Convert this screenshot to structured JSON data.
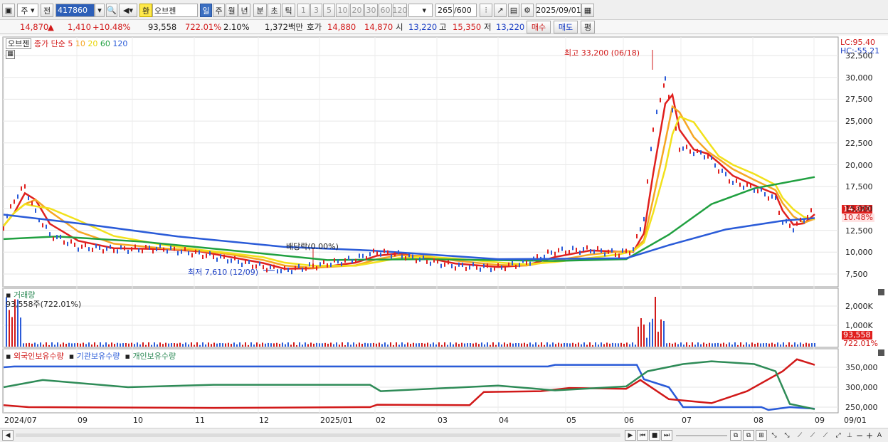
{
  "toolbar": {
    "market": "주",
    "prev": "전",
    "code": "417860",
    "tag": "환",
    "name": "오브젠",
    "periods": [
      "일",
      "주",
      "월",
      "년",
      "분",
      "초",
      "틱"
    ],
    "minutes": [
      "1",
      "3",
      "5",
      "10",
      "20",
      "30",
      "60",
      "120"
    ],
    "count": "265",
    "count_total": "/600",
    "date": "2025/09/01"
  },
  "info": {
    "price": "14,870",
    "change": "1,410",
    "change_pct": "+10.48%",
    "volume": "93,558",
    "volume_pct": "722.01%",
    "turnover": "2.10%",
    "amount": "1,372백만",
    "ask_label": "호가",
    "ask1": "14,880",
    "ask2": "14,870",
    "open_label": "시",
    "open": "13,220",
    "high_label": "고",
    "high": "15,350",
    "low_label": "저",
    "low": "13,220",
    "buy": "매수",
    "sell": "매도",
    "eval": "평"
  },
  "price_panel": {
    "name": "오브젠",
    "ma_label": "종가 단순",
    "ma_periods": [
      "5",
      "10",
      "20",
      "60",
      "120"
    ],
    "ma_colors": [
      "#e0201e",
      "#f5a623",
      "#f2e11b",
      "#20a040",
      "#2a5bd8"
    ],
    "lc": "LC:95.40",
    "hc": "HC:-55.21",
    "high_note": "최고 33,200 (06/18)",
    "low_note": "최저 7,610 (12/09)",
    "dividend_note": "배당락(0.00%)",
    "y_ticks": [
      "32,500",
      "30,000",
      "27,500",
      "25,000",
      "22,500",
      "20,000",
      "17,500",
      "15,000",
      "12,500",
      "10,000",
      "7,500"
    ],
    "last_price": "14,870",
    "last_pct": "10.48%"
  },
  "volume_panel": {
    "title": "거래량",
    "value": "93,558주(722.01%)",
    "y_ticks": [
      "2,000K",
      "1,000K"
    ],
    "last_value": "93,558",
    "last_pct": "722.01%"
  },
  "holdings_panel": {
    "series": [
      "외국인보유수량",
      "기관보유수량",
      "개인보유수량"
    ],
    "colors": [
      "#d11919",
      "#2a5bd8",
      "#2e8b57"
    ],
    "y_ticks": [
      "350,000",
      "300,000",
      "250,000"
    ]
  },
  "x_axis": [
    "2024/07",
    "09",
    "10",
    "11",
    "12",
    "2025/01",
    "02",
    "03",
    "04",
    "05",
    "06",
    "07",
    "08",
    "09"
  ],
  "x_axis_right": "09/01"
}
